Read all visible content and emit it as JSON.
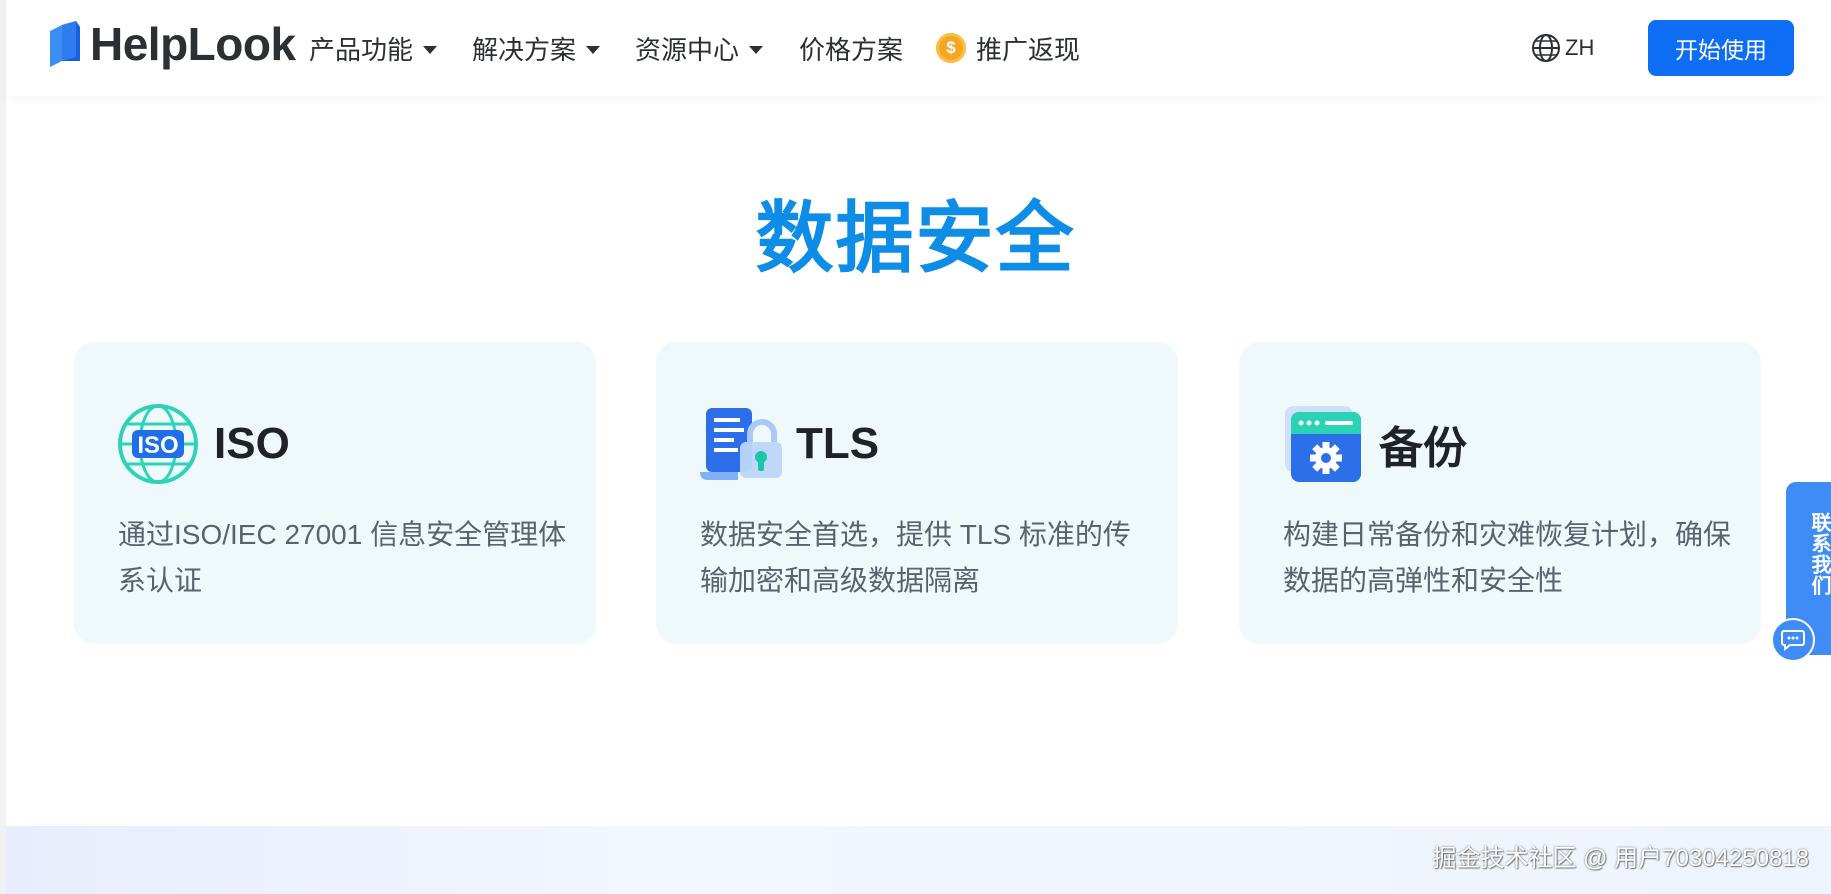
{
  "header": {
    "logo_text": "HelpLook",
    "nav": [
      {
        "label": "产品功能",
        "has_dropdown": true
      },
      {
        "label": "解决方案",
        "has_dropdown": true
      },
      {
        "label": "资源中心",
        "has_dropdown": true
      },
      {
        "label": "价格方案",
        "has_dropdown": false
      },
      {
        "label": "推广返现",
        "has_dropdown": false,
        "icon": "dollar-coin-icon",
        "coin_symbol": "$"
      }
    ],
    "language": {
      "label": "ZH",
      "icon": "globe-icon"
    },
    "start_button": "开始使用"
  },
  "section": {
    "title": "数据安全",
    "cards": [
      {
        "icon": "iso-globe-icon",
        "icon_text": "ISO",
        "title": "ISO",
        "description": "通过ISO/IEC 27001 信息安全管理体系认证"
      },
      {
        "icon": "document-lock-icon",
        "title": "TLS",
        "description": "数据安全首选，提供 TLS 标准的传输加密和高级数据隔离"
      },
      {
        "icon": "backup-gear-window-icon",
        "title": "备份",
        "description": "构建日常备份和灾难恢复计划，确保数据的高弹性和安全性"
      }
    ]
  },
  "floating_contact": {
    "label": "联系我们",
    "icon": "chat-bubble-icon"
  },
  "watermark": "掘金技术社区 @ 用户70304250818",
  "colors": {
    "title_blue": "#0e8de6",
    "button_blue": "#0d6ef5",
    "card_bg": "#eff9fb",
    "iso_teal": "#2ed3b7",
    "coin_orange": "#f5a623"
  }
}
